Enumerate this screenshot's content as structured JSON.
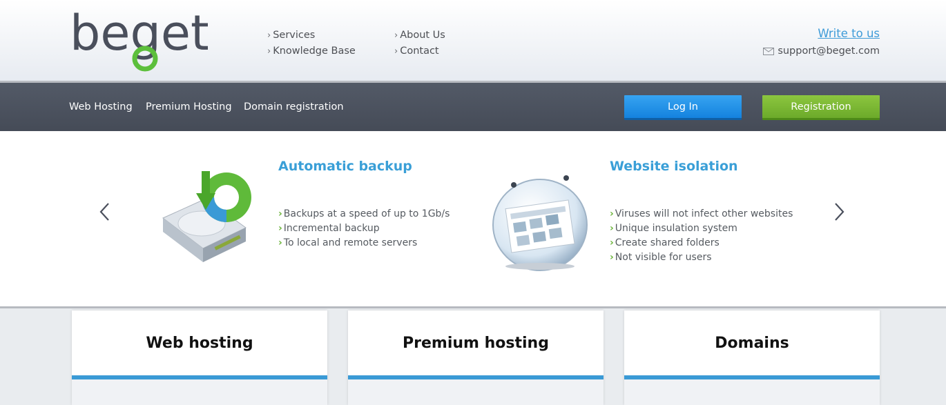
{
  "brand": {
    "logo_text": "beget"
  },
  "header": {
    "nav_col1": [
      "Services",
      "Knowledge Base"
    ],
    "nav_col2": [
      "About Us",
      "Contact"
    ],
    "write_us": "Write to us",
    "support_email": "support@beget.com"
  },
  "navbar": {
    "items": [
      "Web Hosting",
      "Premium Hosting",
      "Domain registration"
    ],
    "login": "Log In",
    "register": "Registration"
  },
  "slider": {
    "features": [
      {
        "title": "Automatic backup",
        "points": [
          "Backups at a speed of up to 1Gb/s",
          "Incremental backup",
          "To local and remote servers"
        ]
      },
      {
        "title": "Website isolation",
        "points": [
          "Viruses will not infect other websites",
          "Unique insulation system",
          "Create shared folders",
          "Not visible for users"
        ]
      }
    ]
  },
  "cards": [
    "Web hosting",
    "Premium hosting",
    "Domains"
  ],
  "colors": {
    "accent_blue": "#3a9fd7",
    "login_blue": "#1a8ae3",
    "register_green": "#7cba35",
    "navbar": "#4b515d"
  },
  "icons": [
    "chevron-right-icon",
    "mail-icon",
    "chevron-left-icon",
    "hard-drive-backup-icon",
    "isolation-sphere-icon"
  ]
}
